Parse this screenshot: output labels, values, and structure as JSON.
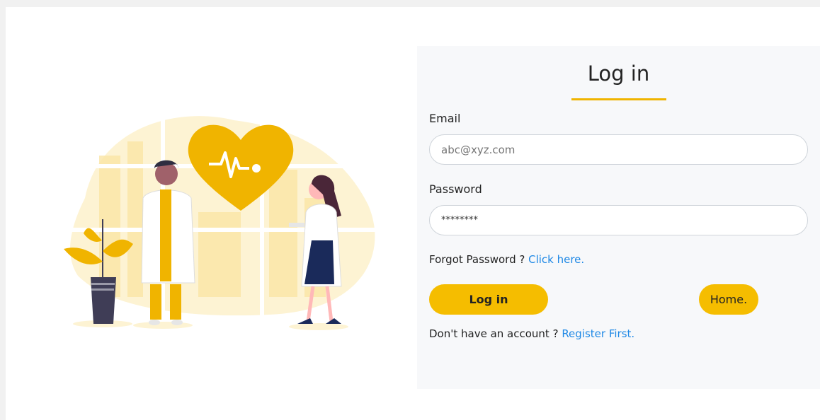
{
  "login": {
    "title": "Log in",
    "email_label": "Email",
    "email_placeholder": "abc@xyz.com",
    "password_label": "Password",
    "password_value": "********",
    "forgot_text": "Forgot Password ? ",
    "forgot_link": "Click here.",
    "login_button": "Log in",
    "home_button": "Home.",
    "register_text": "Don't have an account ? ",
    "register_link": "Register First."
  },
  "colors": {
    "accent": "#f5bd00",
    "link": "#1e88e5",
    "card_bg": "#f7f8fa"
  },
  "illustration": {
    "icons": [
      "doctor-icon",
      "heartbeat-heart-icon",
      "plant-icon"
    ]
  }
}
